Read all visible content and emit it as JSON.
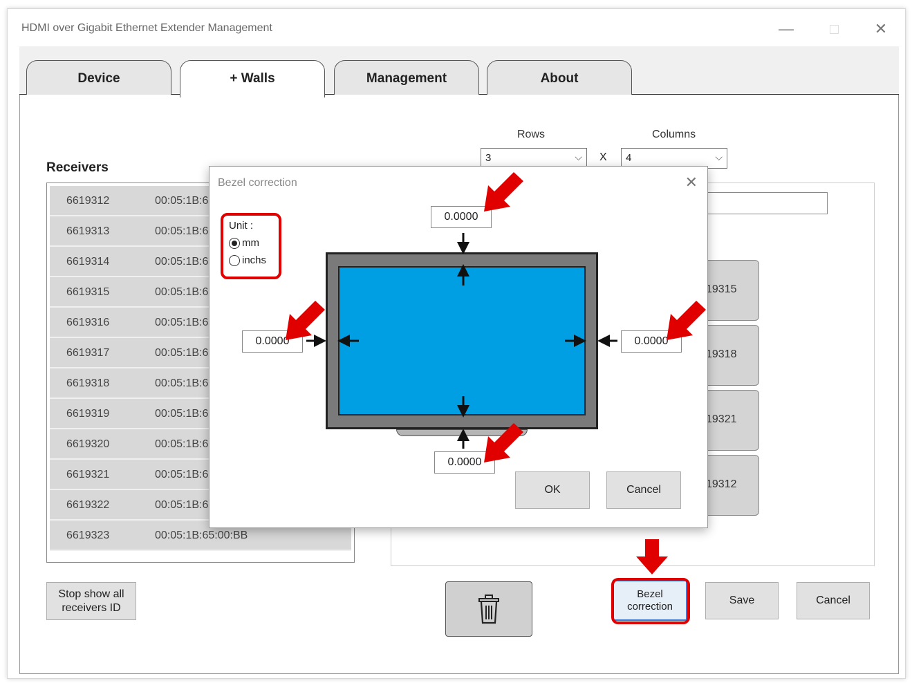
{
  "window": {
    "title": "HDMI over Gigabit Ethernet Extender Management",
    "minimize_glyph": "—",
    "close_glyph": "✕"
  },
  "tabs": [
    {
      "label": "Device"
    },
    {
      "label": "+ Walls"
    },
    {
      "label": "Management"
    },
    {
      "label": "About"
    }
  ],
  "wall_config": {
    "rows_label": "Rows",
    "rows_value": "3",
    "columns_label": "Columns",
    "columns_value": "4",
    "x_label": "X"
  },
  "receivers": {
    "title": "Receivers",
    "items": [
      {
        "id": "6619312",
        "mac": "00:05:1B:6"
      },
      {
        "id": "6619313",
        "mac": "00:05:1B:6"
      },
      {
        "id": "6619314",
        "mac": "00:05:1B:6"
      },
      {
        "id": "6619315",
        "mac": "00:05:1B:6"
      },
      {
        "id": "6619316",
        "mac": "00:05:1B:6"
      },
      {
        "id": "6619317",
        "mac": "00:05:1B:6"
      },
      {
        "id": "6619318",
        "mac": "00:05:1B:6"
      },
      {
        "id": "6619319",
        "mac": "00:05:1B:6"
      },
      {
        "id": "6619320",
        "mac": "00:05:1B:6"
      },
      {
        "id": "6619321",
        "mac": "00:05:1B:6"
      },
      {
        "id": "6619322",
        "mac": "00:05:1B:6"
      },
      {
        "id": "6619323",
        "mac": "00:05:1B:65:00:BB"
      }
    ]
  },
  "wall_cells": [
    "19315",
    "19318",
    "19321",
    "19312"
  ],
  "buttons": {
    "stop_show": "Stop show all receivers ID",
    "bezel": "Bezel correction",
    "save": "Save",
    "cancel": "Cancel",
    "trash_icon": "trash-icon"
  },
  "dialog": {
    "title": "Bezel correction",
    "close_glyph": "✕",
    "unit_label": "Unit :",
    "unit_options": [
      "mm",
      "inchs"
    ],
    "unit_selected": "mm",
    "top_value": "0.0000",
    "left_value": "0.0000",
    "right_value": "0.0000",
    "bottom_value": "0.0000",
    "ok": "OK",
    "cancel": "Cancel"
  },
  "colors": {
    "screen": "#009fe3",
    "bezel": "#7a7a7a",
    "highlight": "#e00000"
  }
}
